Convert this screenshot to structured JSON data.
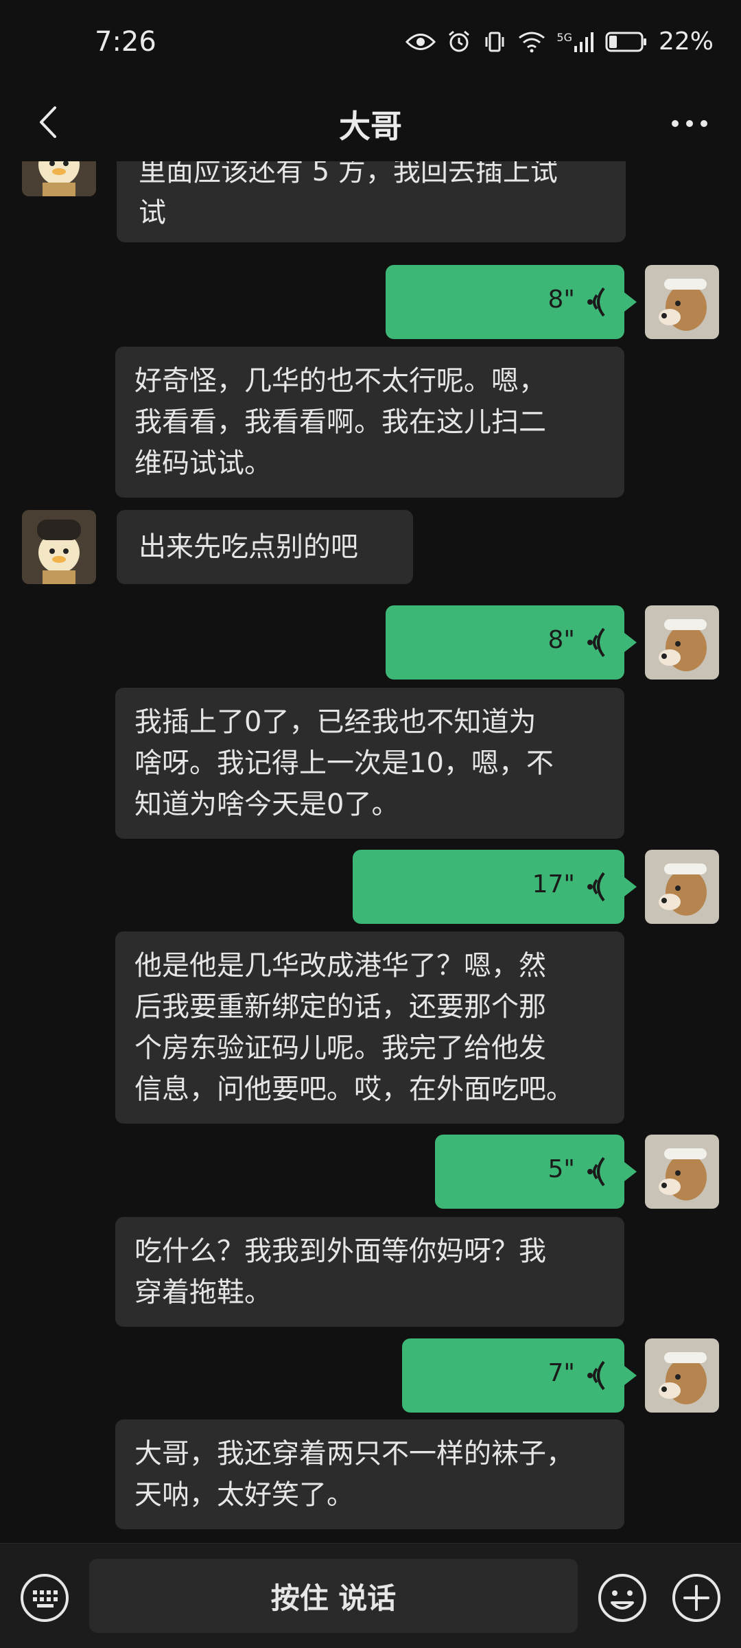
{
  "status": {
    "time": "7:26",
    "network": "5G",
    "battery": "22%"
  },
  "header": {
    "title": "大哥"
  },
  "messages": [
    {
      "side": "them",
      "type": "text",
      "text": "里面应该还有 5 方，我回去插上试\n试"
    },
    {
      "side": "me",
      "type": "voice",
      "duration": "8\""
    },
    {
      "side": "them",
      "type": "text",
      "text": "好奇怪，几华的也不太行呢。嗯，\n我看看，我看看啊。我在这儿扫二\n维码试试。"
    },
    {
      "side": "them",
      "type": "text",
      "text": "出来先吃点别的吧"
    },
    {
      "side": "me",
      "type": "voice",
      "duration": "8\""
    },
    {
      "side": "them",
      "type": "text",
      "text": "我插上了0了，已经我也不知道为\n啥呀。我记得上一次是10，嗯，不\n知道为啥今天是0了。"
    },
    {
      "side": "me",
      "type": "voice",
      "duration": "17\""
    },
    {
      "side": "them",
      "type": "text",
      "text": "他是他是几华改成港华了？嗯，然\n后我要重新绑定的话，还要那个那\n个房东验证码儿呢。我完了给他发\n信息，问他要吧。哎，在外面吃吧。"
    },
    {
      "side": "me",
      "type": "voice",
      "duration": "5\""
    },
    {
      "side": "them",
      "type": "text",
      "text": "吃什么？我我到外面等你妈呀？我\n穿着拖鞋。"
    },
    {
      "side": "me",
      "type": "voice",
      "duration": "7\""
    },
    {
      "side": "them",
      "type": "text",
      "text": "大哥，我还穿着两只不一样的袜子，\n天呐，太好笑了。"
    }
  ],
  "input": {
    "hold_to_talk": "按住 说话"
  },
  "colors": {
    "background": "#111111",
    "bubble_them": "#2c2c2c",
    "bubble_me": "#3cb776"
  },
  "icons": [
    "eye-icon",
    "alarm-icon",
    "vibrate-icon",
    "wifi-icon",
    "signal-icon",
    "battery-icon",
    "back-arrow-icon",
    "more-icon",
    "voice-wave-icon",
    "keyboard-icon",
    "emoji-icon",
    "plus-icon"
  ]
}
